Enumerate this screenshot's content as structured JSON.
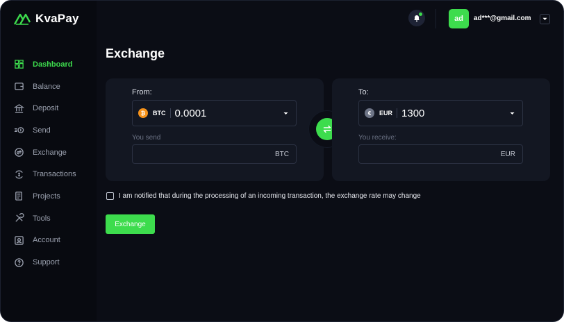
{
  "brand": {
    "name": "KvaPay"
  },
  "sidebar": {
    "items": [
      {
        "label": "Dashboard",
        "icon": "dashboard-icon",
        "active": true
      },
      {
        "label": "Balance",
        "icon": "wallet-icon"
      },
      {
        "label": "Deposit",
        "icon": "bank-icon"
      },
      {
        "label": "Send",
        "icon": "send-icon"
      },
      {
        "label": "Exchange",
        "icon": "exchange-icon"
      },
      {
        "label": "Transactions",
        "icon": "transactions-icon"
      },
      {
        "label": "Projects",
        "icon": "projects-icon"
      },
      {
        "label": "Tools",
        "icon": "tools-icon"
      },
      {
        "label": "Account",
        "icon": "account-icon"
      },
      {
        "label": "Support",
        "icon": "support-icon"
      }
    ]
  },
  "header": {
    "avatar_initials": "ad",
    "user_email": "ad***@gmail.com",
    "notification_icon": "bell-icon"
  },
  "page": {
    "title": "Exchange"
  },
  "from": {
    "label": "From:",
    "currency_code": "BTC",
    "amount": "0.0001",
    "send_label": "You send",
    "send_suffix": "BTC"
  },
  "to": {
    "label": "To:",
    "currency_code": "EUR",
    "amount": "1300",
    "receive_label": "You receive:",
    "receive_suffix": "EUR"
  },
  "notice": {
    "text": "I am notified that during the processing of an incoming transaction, the exchange rate may change"
  },
  "actions": {
    "exchange_label": "Exchange"
  },
  "colors": {
    "accent": "#3ddc4d",
    "background": "#0b0d15",
    "card": "#131722",
    "btc": "#f7931a"
  }
}
